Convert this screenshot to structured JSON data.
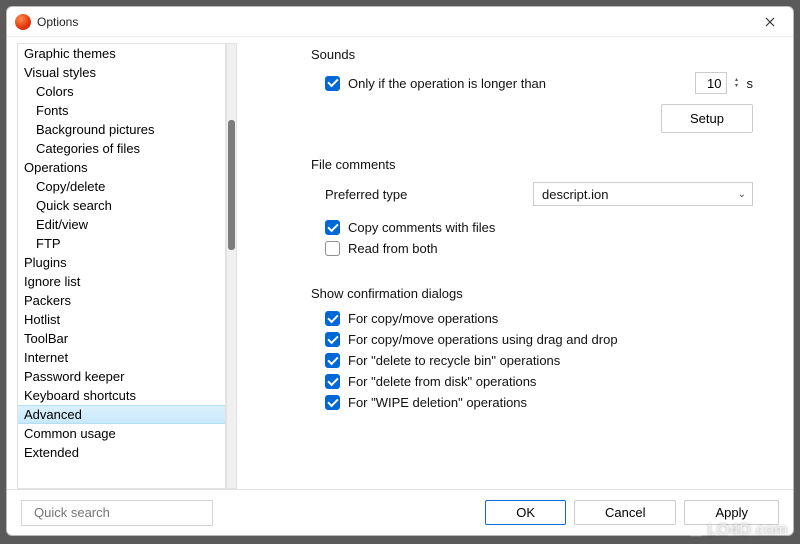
{
  "titlebar": {
    "title": "Options"
  },
  "sidebar": {
    "items": [
      {
        "label": "Graphic themes",
        "indent": 0
      },
      {
        "label": "Visual styles",
        "indent": 0
      },
      {
        "label": "Colors",
        "indent": 1
      },
      {
        "label": "Fonts",
        "indent": 1
      },
      {
        "label": "Background pictures",
        "indent": 1
      },
      {
        "label": "Categories of files",
        "indent": 1
      },
      {
        "label": "Operations",
        "indent": 0
      },
      {
        "label": "Copy/delete",
        "indent": 1
      },
      {
        "label": "Quick search",
        "indent": 1
      },
      {
        "label": "Edit/view",
        "indent": 1
      },
      {
        "label": "FTP",
        "indent": 1
      },
      {
        "label": "Plugins",
        "indent": 0
      },
      {
        "label": "Ignore list",
        "indent": 0
      },
      {
        "label": "Packers",
        "indent": 0
      },
      {
        "label": "Hotlist",
        "indent": 0
      },
      {
        "label": "ToolBar",
        "indent": 0
      },
      {
        "label": "Internet",
        "indent": 0
      },
      {
        "label": "Password keeper",
        "indent": 0
      },
      {
        "label": "Keyboard shortcuts",
        "indent": 0
      },
      {
        "label": "Advanced",
        "indent": 0,
        "selected": true
      },
      {
        "label": "Common usage",
        "indent": 0
      },
      {
        "label": "Extended",
        "indent": 0
      }
    ]
  },
  "sounds": {
    "title": "Sounds",
    "only_if_label": "Only if the operation is longer than",
    "only_if_checked": true,
    "seconds_value": "10",
    "seconds_suffix": "s",
    "setup_button": "Setup"
  },
  "file_comments": {
    "title": "File comments",
    "preferred_type_label": "Preferred type",
    "preferred_type_value": "descript.ion",
    "copy_with_files": {
      "label": "Copy comments with files",
      "checked": true
    },
    "read_both": {
      "label": "Read from both",
      "checked": false
    }
  },
  "confirm": {
    "title": "Show confirmation dialogs",
    "items": [
      {
        "label": "For copy/move operations",
        "checked": true
      },
      {
        "label": "For copy/move operations using drag and drop",
        "checked": true
      },
      {
        "label": "For \"delete to recycle bin\" operations",
        "checked": true
      },
      {
        "label": "For \"delete from disk\" operations",
        "checked": true
      },
      {
        "label": "For \"WIPE deletion\" operations",
        "checked": true
      }
    ]
  },
  "footer": {
    "search_placeholder": "Quick search",
    "ok": "OK",
    "cancel": "Cancel",
    "apply": "Apply"
  },
  "watermark": "LO4D.com"
}
